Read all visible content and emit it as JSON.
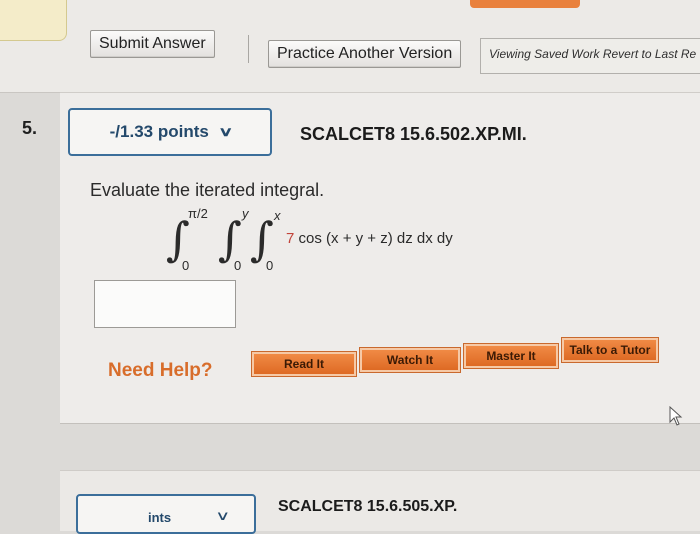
{
  "toolbar": {
    "submit_label": "Submit Answer",
    "practice_label": "Practice Another Version",
    "saved_work_text": "Viewing Saved Work Revert to Last Re"
  },
  "question": {
    "number": "5.",
    "points": "-/1.33 points",
    "code": "SCALCET8 15.6.502.XP.MI.",
    "prompt": "Evaluate the iterated integral.",
    "integral": {
      "outer_upper": "π/2",
      "outer_lower": "0",
      "middle_upper": "y",
      "middle_lower": "0",
      "inner_upper": "x",
      "inner_lower": "0",
      "coefficient": "7",
      "expression": "cos (x + y + z) dz dx dy"
    },
    "answer_value": ""
  },
  "help": {
    "label": "Need Help?",
    "buttons": [
      "Read It",
      "Watch It",
      "Master It",
      "Talk to a Tutor"
    ]
  },
  "next_question": {
    "points_partial": "ints",
    "code": "SCALCET8 15.6.505.XP."
  },
  "colors": {
    "accent_blue": "#3b6e9a",
    "help_orange": "#e9813d",
    "coefficient_red": "#c2433a"
  }
}
